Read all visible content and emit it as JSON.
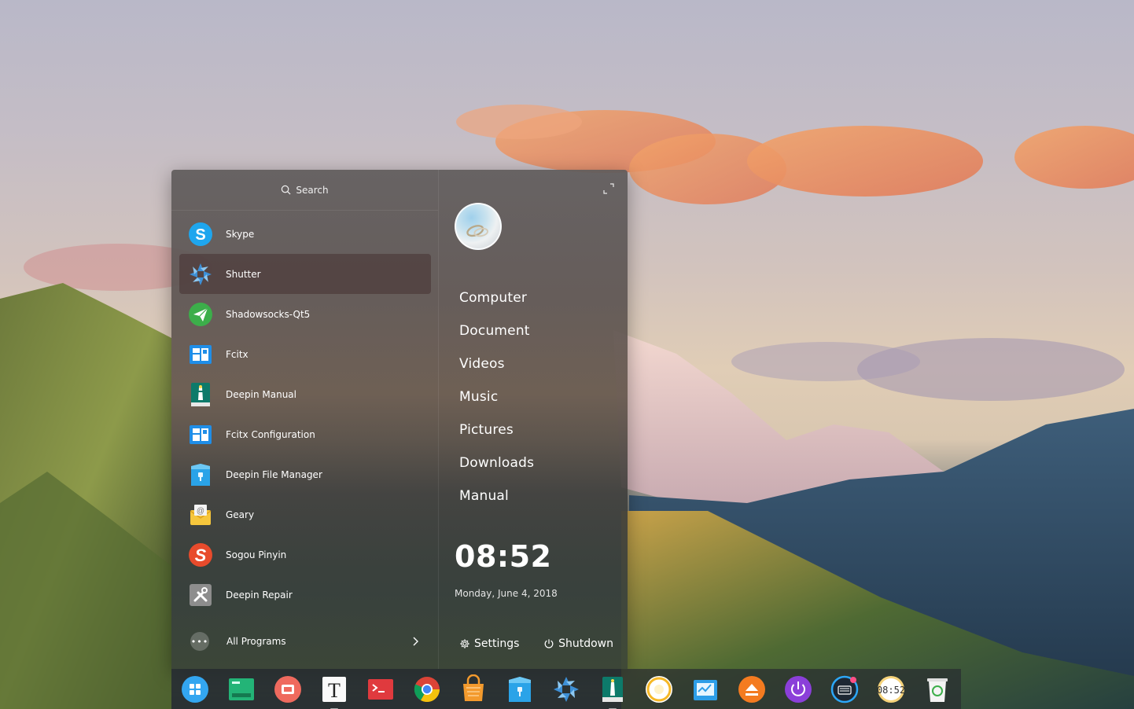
{
  "launcher": {
    "search_placeholder": "Search",
    "apps": [
      {
        "label": "Skype",
        "icon": "skype-icon"
      },
      {
        "label": "Shutter",
        "icon": "shutter-icon",
        "selected": true
      },
      {
        "label": "Shadowsocks-Qt5",
        "icon": "shadowsocks-icon"
      },
      {
        "label": "Fcitx",
        "icon": "fcitx-icon"
      },
      {
        "label": "Deepin Manual",
        "icon": "deepin-manual-icon"
      },
      {
        "label": "Fcitx Configuration",
        "icon": "fcitx-config-icon"
      },
      {
        "label": "Deepin File Manager",
        "icon": "file-manager-icon"
      },
      {
        "label": "Geary",
        "icon": "geary-icon"
      },
      {
        "label": "Sogou Pinyin",
        "icon": "sogou-icon"
      },
      {
        "label": "Deepin Repair",
        "icon": "deepin-repair-icon"
      }
    ],
    "all_programs_label": "All Programs",
    "places": [
      "Computer",
      "Document",
      "Videos",
      "Music",
      "Pictures",
      "Downloads",
      "Manual"
    ],
    "clock": "08:52",
    "date": "Monday, June 4, 2018",
    "settings_label": "Settings",
    "shutdown_label": "Shutdown"
  },
  "dock": {
    "items": [
      {
        "icon": "launcher-icon"
      },
      {
        "icon": "terminal-green-icon"
      },
      {
        "icon": "screen-recorder-icon"
      },
      {
        "icon": "text-editor-icon"
      },
      {
        "icon": "terminal-red-icon"
      },
      {
        "icon": "chrome-icon"
      },
      {
        "icon": "app-store-icon"
      },
      {
        "icon": "file-manager-icon"
      },
      {
        "icon": "shutter-icon"
      },
      {
        "icon": "deepin-manual-icon"
      },
      {
        "icon": "music-player-icon"
      },
      {
        "icon": "system-monitor-icon"
      },
      {
        "icon": "eject-icon"
      },
      {
        "icon": "power-icon"
      },
      {
        "icon": "keyboard-icon"
      },
      {
        "icon": "clock-icon",
        "text": "08:52"
      },
      {
        "icon": "trash-icon"
      }
    ]
  },
  "colors": {
    "accent": "#2ca7f8",
    "selected_row": "#5a3f3f"
  }
}
